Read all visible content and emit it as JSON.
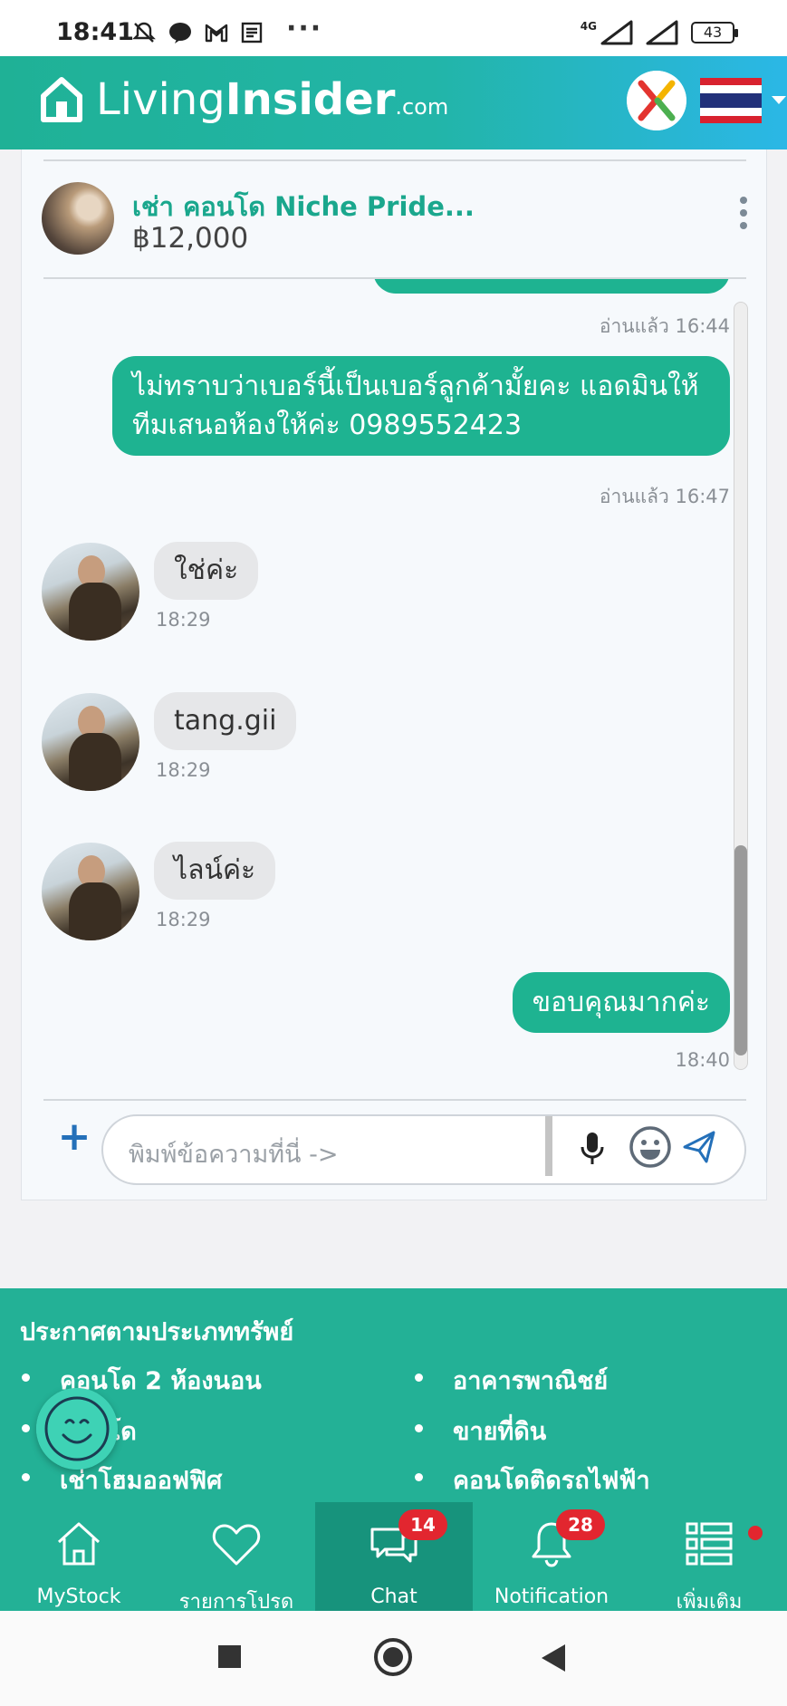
{
  "status_bar": {
    "time": "18:41",
    "network": "4G",
    "battery": "43"
  },
  "header": {
    "logo_living": "Living",
    "logo_insider": "Insider",
    "logo_domain": ".com",
    "brand_color": "#1fb196"
  },
  "listing": {
    "title": "เช่า คอนโด Niche Pride...",
    "price": "฿12,000"
  },
  "messages": [
    {
      "side": "out",
      "text": "",
      "meta": "อ่านแล้ว  16:44"
    },
    {
      "side": "out",
      "text_line1": "ไม่ทราบว่าเบอร์นี้เป็นเบอร์ลูกค้ามั้ยคะ แอดมินให้",
      "text_line2": "ทีมเสนอห้องให้ค่ะ 0989552423",
      "meta": "อ่านแล้ว  16:47"
    },
    {
      "side": "in",
      "text": "ใช่ค่ะ",
      "meta": "18:29"
    },
    {
      "side": "in",
      "text": "tang.gii",
      "meta": "18:29"
    },
    {
      "side": "in",
      "text": "ไลน์ค่ะ",
      "meta": "18:29"
    },
    {
      "side": "out",
      "text": "ขอบคุณมากค่ะ",
      "meta": "18:40"
    }
  ],
  "composer": {
    "placeholder": "พิมพ์ข้อความที่นี่ ->",
    "plus": "+"
  },
  "footer": {
    "title": "ประกาศตามประเภททรัพย์",
    "left_items": [
      "คอนโด 2 ห้องนอน",
      "คอนโด",
      "เช่าโฮมออฟฟิศ"
    ],
    "right_items": [
      "อาคารพาณิชย์",
      "ขายที่ดิน",
      "คอนโดติดรถไฟฟ้า"
    ]
  },
  "bottom_nav": {
    "items": [
      {
        "label": "MyStock",
        "icon": "home-icon"
      },
      {
        "label": "รายการโปรด",
        "icon": "heart-icon"
      },
      {
        "label": "Chat",
        "icon": "chat-icon",
        "badge": "14"
      },
      {
        "label": "Notification",
        "icon": "bell-icon",
        "badge": "28"
      },
      {
        "label": "เพิ่มเติม",
        "icon": "menu-list-icon"
      }
    ],
    "active": "Chat"
  }
}
